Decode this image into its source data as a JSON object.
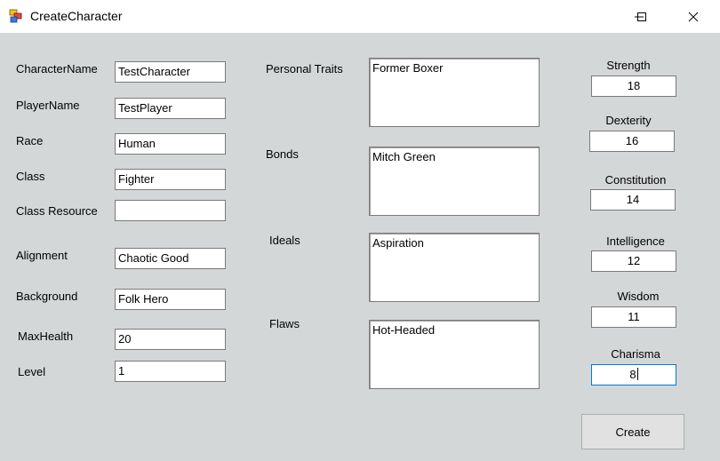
{
  "window": {
    "title": "CreateCharacter",
    "icons": {
      "app": "app-icon",
      "minimize": "minimize-icon",
      "maximize": "maximize-icon",
      "close": "close-icon"
    }
  },
  "left_fields": [
    {
      "label": "CharacterName",
      "value": "TestCharacter"
    },
    {
      "label": "PlayerName",
      "value": "TestPlayer"
    },
    {
      "label": "Race",
      "value": "Human"
    },
    {
      "label": "Class",
      "value": "Fighter"
    },
    {
      "label": "Class Resource",
      "value": ""
    },
    {
      "label": "Alignment",
      "value": "Chaotic Good"
    },
    {
      "label": "Background",
      "value": "Folk Hero"
    },
    {
      "label": "MaxHealth",
      "value": "20"
    },
    {
      "label": "Level",
      "value": "1"
    }
  ],
  "text_areas": [
    {
      "label": "Personal Traits",
      "value": "Former Boxer"
    },
    {
      "label": "Bonds",
      "value": "Mitch Green"
    },
    {
      "label": "Ideals",
      "value": "Aspiration"
    },
    {
      "label": "Flaws",
      "value": "Hot-Headed"
    }
  ],
  "stats": [
    {
      "label": "Strength",
      "value": "18"
    },
    {
      "label": "Dexterity",
      "value": "16"
    },
    {
      "label": "Constitution",
      "value": "14"
    },
    {
      "label": "Intelligence",
      "value": "12"
    },
    {
      "label": "Wisdom",
      "value": "11"
    },
    {
      "label": "Charisma",
      "value": "8"
    }
  ],
  "buttons": {
    "create": "Create"
  },
  "colors": {
    "window_bg": "#d4d7d8",
    "titlebar_bg": "#ffffff",
    "focus_border": "#0078d7",
    "button_bg": "#e1e1e1"
  }
}
